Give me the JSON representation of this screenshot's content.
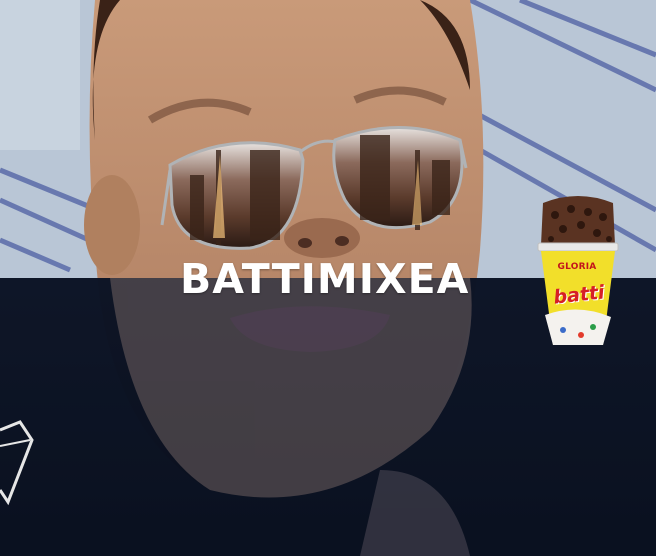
{
  "overlay": {
    "title": "BATTIMIXEA"
  },
  "product": {
    "maker": "GLORIA",
    "brand": "batti"
  },
  "colors": {
    "dark_band": "#0d1426",
    "title": "#ffffff",
    "cup_yellow": "#f2df2a",
    "brand_red": "#d61f26"
  },
  "icons": {
    "corner": "diamond-outline-icon"
  }
}
